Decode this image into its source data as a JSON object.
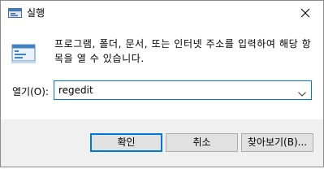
{
  "window": {
    "title": "실행",
    "title_icon": "run-dialog-icon",
    "close_icon": "close-icon"
  },
  "body": {
    "icon": "run-app-icon",
    "description": "프로그램, 폴더, 문서, 또는 인터넷 주소를 입력하여 해당 항목을 열 수 있습니다.",
    "open_label": "열기(O):",
    "open_value": "regedit",
    "caret_icon": "chevron-down-icon"
  },
  "footer": {
    "ok_label": "확인",
    "cancel_label": "취소",
    "browse_label": "찾아보기(B)..."
  },
  "colors": {
    "accent": "#0078d7",
    "footer_bg": "#f0f0f0",
    "button_bg": "#e1e1e1"
  }
}
